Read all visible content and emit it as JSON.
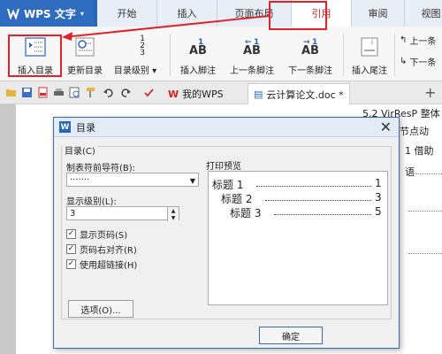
{
  "app": {
    "name": "WPS 文字",
    "caret": "▾",
    "accent": "#2a66b6"
  },
  "menu": {
    "tabs": [
      "开始",
      "插入",
      "页面布局",
      "引用",
      "审阅",
      "视图"
    ],
    "active_index": 3
  },
  "ribbon": {
    "toc": "插入目录",
    "update_toc": "更新目录",
    "toc_level": "目录级别",
    "toc_level_caret": "▾",
    "insert_footnote": "插入脚注",
    "prev_footnote": "上一条脚注",
    "next_footnote": "下一条脚注",
    "insert_endnote": "插入尾注",
    "prev_small": "上一条",
    "next_small": "下一条",
    "ab_text": "AB",
    "footnote_sup": "1",
    "level_digits": [
      "1",
      "2",
      "3"
    ]
  },
  "doc_tabs": {
    "tab1": "我的WPS",
    "tab2": "云计算论文.doc *",
    "plus": "+"
  },
  "document": {
    "lines": [
      "5.2 VirResP 整体",
      "节点动",
      "1 借助",
      "语"
    ]
  },
  "dialog": {
    "title": "目录",
    "icon_letter": "W",
    "close": "✕",
    "group_label": "目录(C)",
    "tab_leader_label": "制表符前导符(B):",
    "tab_leader_value": "·······",
    "show_levels_label": "显示级别(L):",
    "show_levels_value": "3",
    "checkboxes": [
      {
        "label": "显示页码(S)",
        "checked": true
      },
      {
        "label": "页码右对齐(R)",
        "checked": true
      },
      {
        "label": "使用超链接(H)",
        "checked": true
      }
    ],
    "check_mark": "✓",
    "options_button": "选项(O)...",
    "ok_button": "确定",
    "preview_label": "打印预览",
    "preview": [
      {
        "title": "标题 1",
        "page": "1"
      },
      {
        "title": "标题 2",
        "page": "3"
      },
      {
        "title": "标题 3",
        "page": "5"
      }
    ]
  }
}
